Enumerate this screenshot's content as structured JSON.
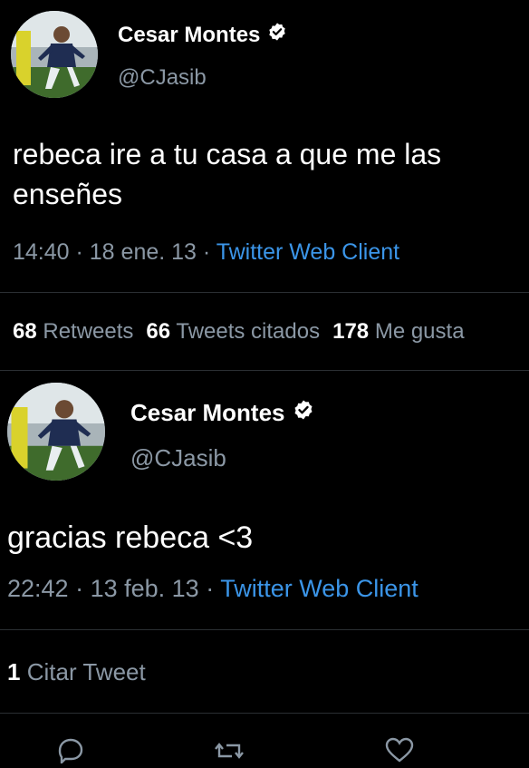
{
  "tweets": [
    {
      "author": {
        "name": "Cesar Montes",
        "handle": "@CJasib"
      },
      "text": "rebeca ire a tu casa a que me las\nenseñes",
      "time": "14:40",
      "date": "18 ene. 13",
      "client": "Twitter Web Client",
      "stats": {
        "retweets_count": "68",
        "retweets_label": "Retweets",
        "quotes_count": "66",
        "quotes_label": "Tweets citados",
        "likes_count": "178",
        "likes_label": "Me gusta"
      }
    },
    {
      "author": {
        "name": "Cesar Montes",
        "handle": "@CJasib"
      },
      "text": "gracias rebeca <3",
      "time": "22:42",
      "date": "13 feb. 13",
      "client": "Twitter Web Client",
      "stats": {
        "quotes_count": "1",
        "quotes_label": "Citar Tweet"
      }
    }
  ],
  "meta_separator": " · ",
  "actions": [
    "reply-icon",
    "retweet-icon",
    "like-icon"
  ],
  "colors": {
    "background": "#000000",
    "text": "#ffffff",
    "secondary": "#8b98a5",
    "link": "#3b95e8",
    "divider": "#2b2f33"
  }
}
